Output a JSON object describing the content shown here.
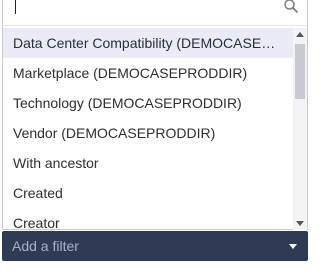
{
  "search": {
    "value": "",
    "placeholder": ""
  },
  "options": [
    {
      "label": "Data Center Compatibility (DEMOCASEPR...",
      "active": true
    },
    {
      "label": "Marketplace (DEMOCASEPRODDIR)"
    },
    {
      "label": "Technology (DEMOCASEPRODDIR)"
    },
    {
      "label": "Vendor (DEMOCASEPRODDIR)"
    },
    {
      "label": "With ancestor"
    },
    {
      "label": "Created"
    },
    {
      "label": "Creator"
    }
  ],
  "filter": {
    "placeholder_label": "Add a filter"
  },
  "colors": {
    "filter_bar": "#2f3b55",
    "active_option": "#e9ecf6"
  }
}
